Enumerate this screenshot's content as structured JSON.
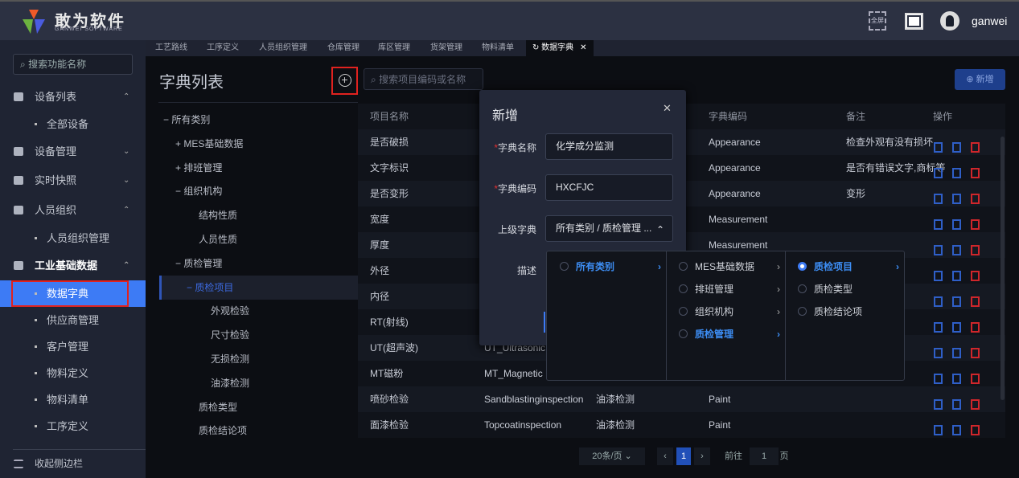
{
  "header": {
    "brand": "敢为软件",
    "brand_sub": "GANWEI SOFTWARE",
    "fullscreen_label": "全屏",
    "username": "ganwei"
  },
  "tabs": [
    "工艺路线",
    "工序定义",
    "人员组织管理",
    "仓库管理",
    "库区管理",
    "货架管理",
    "物料清单",
    "数据字典"
  ],
  "sidebar": {
    "search_placeholder": "搜索功能名称",
    "items": [
      {
        "label": "设备列表",
        "type": "group",
        "chevron": "^"
      },
      {
        "label": "全部设备",
        "type": "sub"
      },
      {
        "label": "设备管理",
        "type": "group",
        "chevron": "v"
      },
      {
        "label": "实时快照",
        "type": "group",
        "chevron": "v"
      },
      {
        "label": "人员组织",
        "type": "group",
        "chevron": "^"
      },
      {
        "label": "人员组织管理",
        "type": "sub"
      },
      {
        "label": "工业基础数据",
        "type": "group",
        "chevron": "^"
      },
      {
        "label": "数据字典",
        "type": "sub",
        "active": true
      },
      {
        "label": "供应商管理",
        "type": "sub"
      },
      {
        "label": "客户管理",
        "type": "sub"
      },
      {
        "label": "物料定义",
        "type": "sub"
      },
      {
        "label": "物料清单",
        "type": "sub"
      },
      {
        "label": "工序定义",
        "type": "sub"
      }
    ],
    "collapse_label": "收起侧边栏"
  },
  "page": {
    "title": "字典列表",
    "search_placeholder": "搜索项目编码或名称",
    "new_label": "新增"
  },
  "tree": [
    {
      "label": "所有类别",
      "prefix": "−",
      "level": 0
    },
    {
      "label": "MES基础数据",
      "prefix": "+",
      "level": 1
    },
    {
      "label": "排班管理",
      "prefix": "+",
      "level": 1
    },
    {
      "label": "组织机构",
      "prefix": "−",
      "level": 1
    },
    {
      "label": "结构性质",
      "prefix": "",
      "level": 2
    },
    {
      "label": "人员性质",
      "prefix": "",
      "level": 2
    },
    {
      "label": "质检管理",
      "prefix": "−",
      "level": 1
    },
    {
      "label": "质检项目",
      "prefix": "−",
      "level": 2,
      "selected": true
    },
    {
      "label": "外观检验",
      "prefix": "",
      "level": 3
    },
    {
      "label": "尺寸检验",
      "prefix": "",
      "level": 3
    },
    {
      "label": "无损检测",
      "prefix": "",
      "level": 3
    },
    {
      "label": "油漆检测",
      "prefix": "",
      "level": 3
    },
    {
      "label": "质检类型",
      "prefix": "",
      "level": 2
    },
    {
      "label": "质检结论项",
      "prefix": "",
      "level": 2
    }
  ],
  "table": {
    "headers": [
      "项目名称",
      "字典编码",
      "备注",
      "操作"
    ],
    "rows": [
      [
        "是否破损",
        "",
        "",
        "Appearance",
        "检查外观有没有损坏"
      ],
      [
        "文字标识",
        "",
        "",
        "Appearance",
        "是否有错误文字,商标等"
      ],
      [
        "是否变形",
        "",
        "",
        "Appearance",
        "变形"
      ],
      [
        "宽度",
        "",
        "",
        "Measurement",
        ""
      ],
      [
        "厚度",
        "",
        "",
        "Measurement",
        ""
      ],
      [
        "外径",
        "",
        "",
        "",
        ""
      ],
      [
        "内径",
        "",
        "",
        "",
        ""
      ],
      [
        "RT(射线)",
        "",
        "",
        "",
        ""
      ],
      [
        "UT(超声波)",
        "UT_Ultrasonic",
        "",
        "",
        ""
      ],
      [
        "MT磁粉",
        "MT_Magnetic",
        "",
        "",
        ""
      ],
      [
        "喷砂检验",
        "Sandblastinginspection",
        "油漆检测",
        "Paint",
        ""
      ],
      [
        "面漆检验",
        "Topcoatinspection",
        "油漆检测",
        "Paint",
        ""
      ]
    ]
  },
  "pagination": {
    "page_size": "20条/页",
    "current": "1",
    "goto_label": "前往",
    "goto_value": "1",
    "page_suffix": "页"
  },
  "modal": {
    "title": "新增",
    "fields": [
      {
        "label": "字典名称",
        "required": true,
        "value": "化学成分监测"
      },
      {
        "label": "字典编码",
        "required": true,
        "value": "HXCFJC"
      },
      {
        "label": "上级字典",
        "value": "所有类别 / 质检管理 ..."
      },
      {
        "label": "描述",
        "value": ""
      }
    ]
  },
  "cascader": [
    [
      {
        "label": "所有类别",
        "highlight": true,
        "arrow": true
      }
    ],
    [
      {
        "label": "MES基础数据",
        "arrow": true
      },
      {
        "label": "排班管理",
        "arrow": true
      },
      {
        "label": "组织机构",
        "arrow": true
      },
      {
        "label": "质检管理",
        "highlight": true,
        "arrow": true
      }
    ],
    [
      {
        "label": "质检项目",
        "highlight": true,
        "checked": true,
        "arrow": true
      },
      {
        "label": "质检类型"
      },
      {
        "label": "质检结论项"
      }
    ]
  ],
  "colors": {
    "accent": "#3d7bf5",
    "danger": "#d0262b",
    "highlight_box": "#e0221f"
  }
}
